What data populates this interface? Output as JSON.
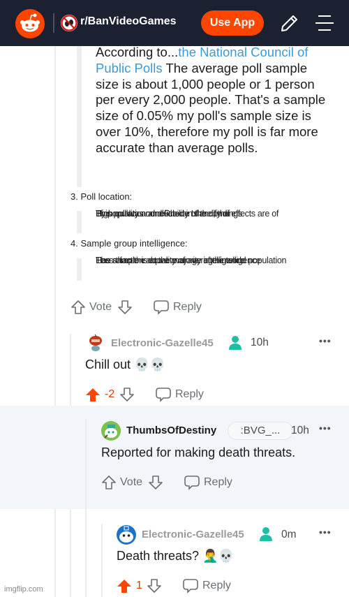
{
  "header": {
    "subreddit": "r/BanVideoGames",
    "use_app_label": "Use App",
    "icons": [
      "reddit-logo-icon",
      "subreddit-icon",
      "pencil-icon",
      "menu-icon"
    ]
  },
  "post_excerpt": {
    "lead": "According to...",
    "link_text": "the National Council of Public Polls",
    "text": " The average poll sample size is about 1,000 people or 1 person per every 2,000 people. That's a sample size of 0.05%  my poll's sample size is over 10%, therefore my poll is far more accurate than average polls.",
    "sections": [
      {
        "heading": "3. Poll location:",
        "overlapping_lines": [
          "This poll was conducted in the city of",
          "By population and Rhode Island, the effects are of",
          "High quality and reliability of the findings"
        ]
      },
      {
        "heading": "4. Sample group intelligence:",
        "overlapping_lines": [
          "The sample is at the majority of the world population",
          "Has a faction above average intelligence",
          "Less than the equality of average intelligence"
        ]
      }
    ],
    "vote_label": "Vote",
    "reply_label": "Reply"
  },
  "comments": [
    {
      "username": "Electronic-Gazelle45",
      "op_badge_icon": "op-person-icon",
      "time": "10h",
      "text": "Chill out 💀💀",
      "score": "-2",
      "upvoted": true,
      "reply_label": "Reply",
      "more": "•••"
    },
    {
      "username": "ThumbsOfDestiny",
      "flair": ":BVG_...",
      "time": "10h",
      "text": "Reported for making death threats.",
      "vote_label": "Vote",
      "reply_label": "Reply",
      "more": "•••",
      "highlighted": true
    },
    {
      "username": "Electronic-Gazelle45",
      "op_badge_icon": "op-person-icon",
      "time": "0m",
      "text": "Death threats? 🤦‍♂️💀",
      "score": "1",
      "upvoted": true,
      "reply_label": "Reply",
      "more": "•••"
    }
  ],
  "colors": {
    "header_bg": "#1b2130",
    "brand_orange": "#ff4500",
    "link_blue": "#3a9ad9",
    "highlight_bg": "#f2f6fa",
    "op_badge": "#1ebea5",
    "score_orange": "#d93a00"
  },
  "watermark": "imgflip.com"
}
